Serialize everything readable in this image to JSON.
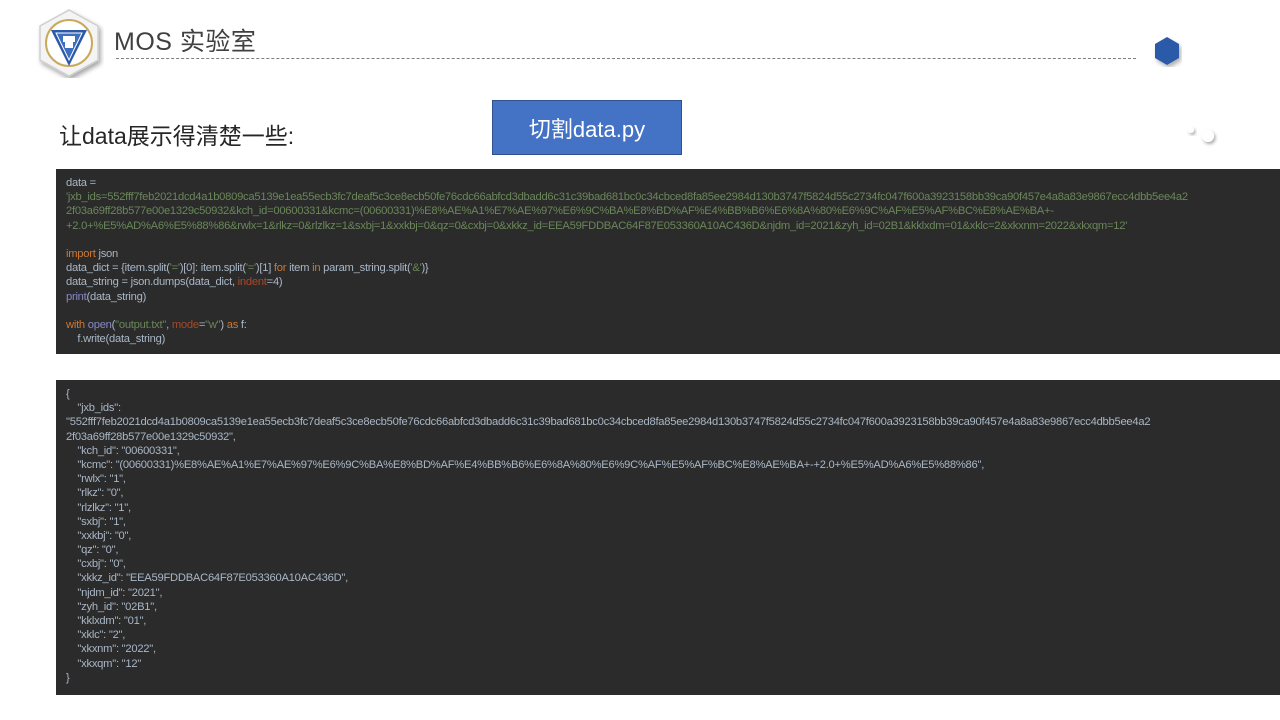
{
  "header": {
    "title": "MOS 实验室",
    "logo_icon": "shield-badge-icon",
    "accent_color": "#2a5aa8"
  },
  "decorations": {
    "hexagon_icon": "hexagon-icon",
    "dots_icon": "dots-icon"
  },
  "content": {
    "subtitle": "让data展示得清楚一些:",
    "file_button_label": "切割data.py"
  },
  "code_panel": {
    "line1": "data =",
    "line2": "'jxb_ids=552fff7feb2021dcd4a1b0809ca5139e1ea55ecb3fc7deaf5c3ce8ecb50fe76cdc66abfcd3dbadd6c31c39bad681bc0c34cbced8fa85ee2984d130b3747f5824d55c2734fc047f600a3923158bb39ca90f457e4a8a83e9867ecc4dbb5ee4a2",
    "line3": "2f03a69ff28b577e00e1329c50932&kch_id=00600331&kcmc=(00600331)%E8%AE%A1%E7%AE%97%E6%9C%BA%E8%BD%AF%E4%BB%B6%E6%8A%80%E6%9C%AF%E5%AF%BC%E8%AE%BA+-",
    "line4": "+2.0+%E5%AD%A6%E5%88%86&rwlx=1&rlkz=0&rlzlkz=1&sxbj=1&xxkbj=0&qz=0&cxbj=0&xkkz_id=EEA59FDDBAC64F87E053360A10AC436D&njdm_id=2021&zyh_id=02B1&kklxdm=01&xklc=2&xkxnm=2022&xkxqm=12'",
    "import_kw": "import",
    "import_mod": " json",
    "dict_a": "data_dict = {item.split(",
    "dict_s1": "'='",
    "dict_b": ")[0]: item.split(",
    "dict_s2": "'='",
    "dict_c": ")[1] ",
    "dict_for": "for",
    "dict_d": " item ",
    "dict_in": "in",
    "dict_e": " param_string.split(",
    "dict_s3": "'&'",
    "dict_f": ")}",
    "dumps_a": "data_string = json.dumps(data_dict, ",
    "dumps_kw": "indent",
    "dumps_b": "=4)",
    "print_fn": "print",
    "print_arg": "(data_string)",
    "with_kw": "with",
    "open_fn": " open",
    "open_a": "(",
    "open_s1": "\"output.txt\"",
    "open_b": ", ",
    "open_kw": "mode",
    "open_c": "=",
    "open_s2": "\"w\"",
    "open_d": ") ",
    "as_kw": "as",
    "open_e": " f:",
    "write_line": "    f.write(data_string)"
  },
  "output_panel": {
    "lines": [
      "{",
      "    \"jxb_ids\":",
      "\"552fff7feb2021dcd4a1b0809ca5139e1ea55ecb3fc7deaf5c3ce8ecb50fe76cdc66abfcd3dbadd6c31c39bad681bc0c34cbced8fa85ee2984d130b3747f5824d55c2734fc047f600a3923158bb39ca90f457e4a8a83e9867ecc4dbb5ee4a2",
      "2f03a69ff28b577e00e1329c50932\",",
      "    \"kch_id\": \"00600331\",",
      "    \"kcmc\": \"(00600331)%E8%AE%A1%E7%AE%97%E6%9C%BA%E8%BD%AF%E4%BB%B6%E6%8A%80%E6%9C%AF%E5%AF%BC%E8%AE%BA+-+2.0+%E5%AD%A6%E5%88%86\",",
      "    \"rwlx\": \"1\",",
      "    \"rlkz\": \"0\",",
      "    \"rlzlkz\": \"1\",",
      "    \"sxbj\": \"1\",",
      "    \"xxkbj\": \"0\",",
      "    \"qz\": \"0\",",
      "    \"cxbj\": \"0\",",
      "    \"xkkz_id\": \"EEA59FDDBAC64F87E053360A10AC436D\",",
      "    \"njdm_id\": \"2021\",",
      "    \"zyh_id\": \"02B1\",",
      "    \"kklxdm\": \"01\",",
      "    \"xklc\": \"2\",",
      "    \"xkxnm\": \"2022\",",
      "    \"xkxqm\": \"12\"",
      "}"
    ]
  }
}
